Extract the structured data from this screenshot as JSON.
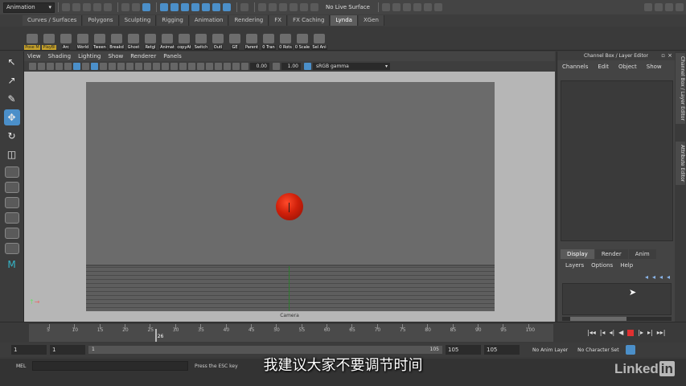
{
  "status_line": {
    "mode": "Animation",
    "live_surface": "No Live Surface"
  },
  "shelf": {
    "tabs": [
      "Curves / Surfaces",
      "Polygons",
      "Sculpting",
      "Rigging",
      "Animation",
      "Rendering",
      "FX",
      "FX Caching",
      "Lynda",
      "XGen"
    ],
    "active_tab": "Lynda",
    "buttons": [
      {
        "label": "Pose M",
        "style": "yellow"
      },
      {
        "label": "PlayBl",
        "style": "yellow"
      },
      {
        "label": "Arc",
        "style": "dark"
      },
      {
        "label": "World",
        "style": "dark"
      },
      {
        "label": "Tween",
        "style": "dark"
      },
      {
        "label": "Breakd",
        "style": "dark"
      },
      {
        "label": "Ghost",
        "style": "dark"
      },
      {
        "label": "Retgl",
        "style": "dark"
      },
      {
        "label": "Animat",
        "style": "dark"
      },
      {
        "label": "copyAt",
        "style": "dark"
      },
      {
        "label": "Switch",
        "style": "dark"
      },
      {
        "label": "Outl",
        "style": "dark"
      },
      {
        "label": "GE",
        "style": "dark"
      },
      {
        "label": "Parent",
        "style": "dark"
      },
      {
        "label": "0 Tran",
        "style": "dark"
      },
      {
        "label": "0 Rots",
        "style": "dark"
      },
      {
        "label": "0 Scale",
        "style": "dark"
      },
      {
        "label": "Sel Ani",
        "style": "dark"
      }
    ]
  },
  "viewport": {
    "menu": [
      "View",
      "Shading",
      "Lighting",
      "Show",
      "Renderer",
      "Panels"
    ],
    "exposure": "0.00",
    "gamma": "1.00",
    "color_space": "sRGB gamma",
    "camera_label": "Camera"
  },
  "channel_box": {
    "title": "Channel Box / Layer Editor",
    "menu": [
      "Channels",
      "Edit",
      "Object",
      "Show"
    ],
    "layer_tabs": [
      "Display",
      "Render",
      "Anim"
    ],
    "active_layer_tab": "Display",
    "layer_menu": [
      "Layers",
      "Options",
      "Help"
    ]
  },
  "side_tabs": [
    "Channel Box / Layer Editor",
    "Attribute Editor"
  ],
  "timeline": {
    "ticks": [
      5,
      10,
      15,
      20,
      25,
      30,
      35,
      40,
      45,
      50,
      55,
      60,
      65,
      70,
      75,
      80,
      85,
      90,
      95,
      100
    ],
    "current_frame": "26",
    "current_frame_value": 26,
    "range_min": 1,
    "range_max": 105
  },
  "range_slider": {
    "start": "1",
    "playback_start": "1",
    "track_start": "1",
    "track_end": "105",
    "playback_end": "105",
    "end": "105",
    "anim_layer": "No Anim Layer",
    "character_set": "No Character Set"
  },
  "command_line": {
    "label": "MEL",
    "help": "Press the ESC key"
  },
  "subtitle": "我建议大家不要调节时间",
  "watermark": {
    "text": "Linked",
    "box": "in"
  }
}
